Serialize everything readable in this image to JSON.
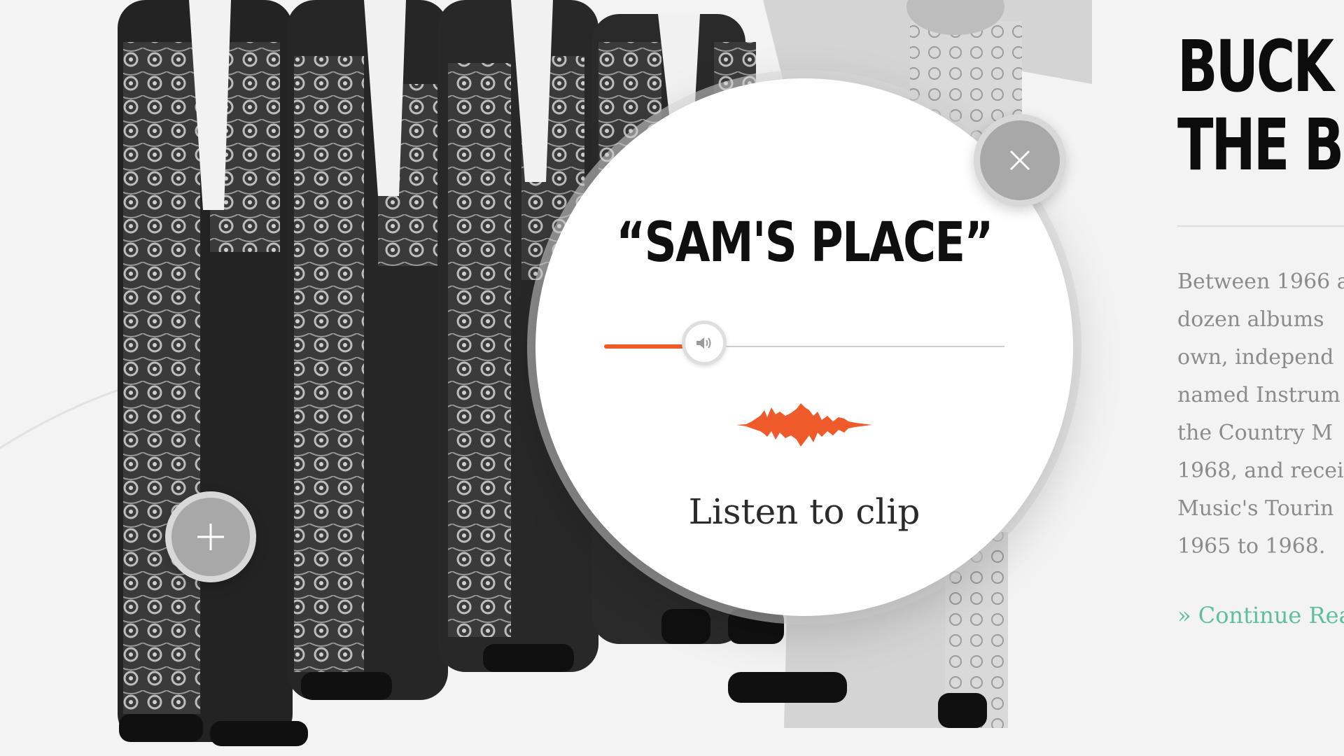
{
  "side_panel": {
    "title_lines": [
      "BUCK",
      "THE B"
    ],
    "body_lines": [
      "Between 1966 a",
      "dozen albums",
      "own, independ",
      "named Instrum",
      "the Country M",
      "1968, and recei",
      "Music's Tourin",
      "1965 to 1968."
    ],
    "continue_link": "» Continue Rea"
  },
  "player": {
    "title": "“SAM'S PLACE”",
    "progress_fraction": 0.25,
    "listen_label": "Listen to clip"
  },
  "icons": {
    "close": "close-icon",
    "plus": "plus-icon",
    "volume": "volume-icon",
    "waveform": "waveform-icon"
  },
  "colors": {
    "accent": "#ef5a2a",
    "link": "#5dbf9c",
    "button_gray": "#a8a8a8"
  }
}
